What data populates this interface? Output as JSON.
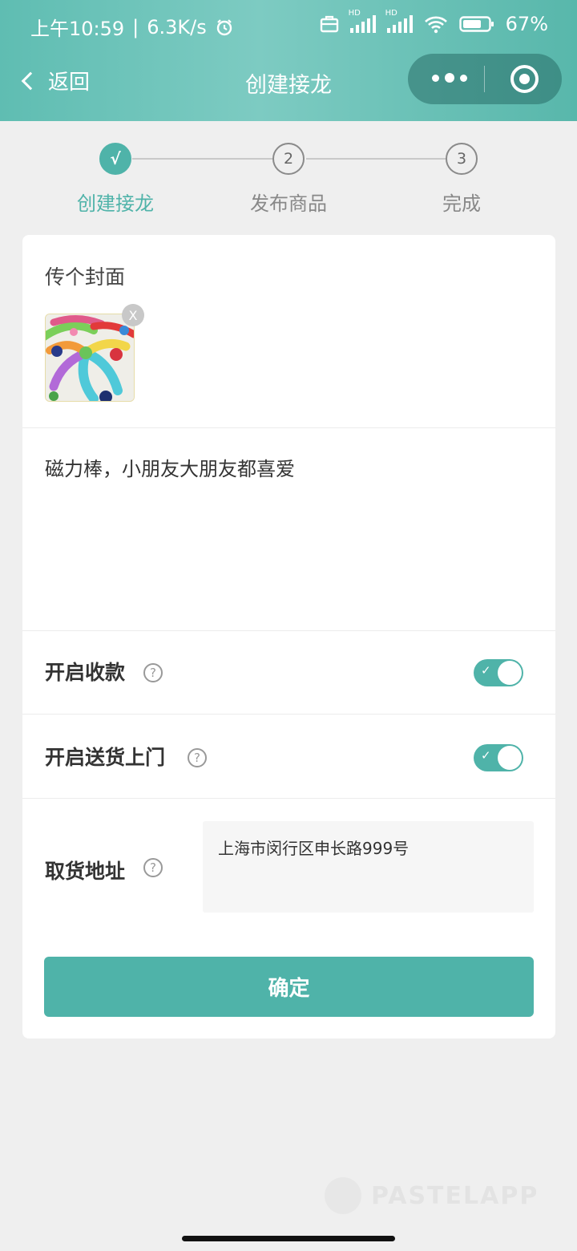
{
  "status_bar": {
    "time": "上午10:59",
    "separator": "|",
    "net_speed": "6.3K/s",
    "alarm_icon": "alarm-icon",
    "briefcase_icon": "briefcase-icon",
    "signal1_tag": "HD",
    "signal2_tag": "HD",
    "battery": "67%"
  },
  "navbar": {
    "back_label": "返回",
    "title": "创建接龙"
  },
  "steps": [
    {
      "marker": "√",
      "label": "创建接龙",
      "state": "done"
    },
    {
      "marker": "2",
      "label": "发布商品",
      "state": "pending"
    },
    {
      "marker": "3",
      "label": "完成",
      "state": "pending"
    }
  ],
  "form": {
    "cover_label": "传个封面",
    "remove_label": "X",
    "description": "磁力棒，小朋友大朋友都喜爱",
    "payment_label": "开启收款",
    "payment_on": true,
    "delivery_label": "开启送货上门",
    "delivery_on": true,
    "pickup_label": "取货地址",
    "pickup_address": "上海市闵行区申长路999号",
    "help_glyph": "?",
    "confirm_label": "确定"
  },
  "colors": {
    "accent": "#4fb3a9",
    "header_gradient": [
      "#5fbdb2",
      "#7dcbc2",
      "#58b7ab"
    ],
    "background": "#efefef"
  }
}
